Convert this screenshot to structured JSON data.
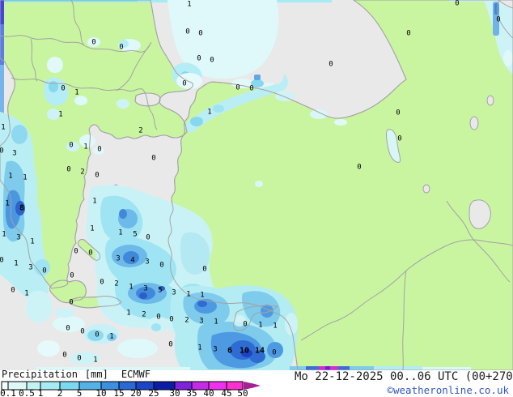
{
  "footer": {
    "legend_title": "Precipitation",
    "legend_unit": "[mm]",
    "legend_model": "ECMWF",
    "datetime": "Mo 22-12-2025 00..06 UTC (00+270",
    "copyright": "©weatheronline.co.uk"
  },
  "legend_scale": {
    "tick_labels": [
      "0.1",
      "0.5",
      "1",
      "2",
      "5",
      "10",
      "15",
      "20",
      "25",
      "30",
      "35",
      "40",
      "45",
      "50"
    ],
    "tick_x": [
      10,
      33,
      50,
      74,
      98,
      125,
      147,
      168,
      190,
      216,
      237,
      258,
      280,
      300
    ],
    "boundaries": [
      2,
      10,
      33,
      50,
      74,
      98,
      125,
      147,
      168,
      190,
      216,
      237,
      258,
      280,
      300
    ],
    "segment_colors": [
      "#f2fdfd",
      "#dcf8f8",
      "#c2f2f2",
      "#a6ebf2",
      "#7cdaf0",
      "#54b2e8",
      "#3b90e0",
      "#2a68d4",
      "#1b44c6",
      "#0a1da4",
      "#7e22dc",
      "#c52ae6",
      "#ee31f0",
      "#fb30cf"
    ],
    "arrow_color": "#a81f96",
    "bar_border_color": "#000000"
  },
  "map_colors": {
    "land": "#c9f5a1",
    "sea": "#e9e9e9",
    "coast": "#a3a3a3",
    "lake": "#d9f6f6"
  },
  "precip_values": [
    [
      234,
      4,
      "1",
      0
    ],
    [
      232,
      38,
      "0",
      0
    ],
    [
      248,
      40,
      "0",
      0
    ],
    [
      116,
      51,
      "0",
      0
    ],
    [
      150,
      57,
      "0",
      0
    ],
    [
      246,
      71,
      "0",
      0
    ],
    [
      262,
      73,
      "0",
      0
    ],
    [
      228,
      102,
      "0",
      0
    ],
    [
      294,
      107,
      "0",
      0
    ],
    [
      311,
      108,
      "0",
      0
    ],
    [
      565,
      3,
      "0",
      0
    ],
    [
      616,
      23,
      "0",
      0
    ],
    [
      505,
      40,
      "0",
      0
    ],
    [
      409,
      78,
      "0",
      0
    ],
    [
      78,
      108,
      "0",
      0
    ],
    [
      95,
      113,
      "1",
      0
    ],
    [
      259,
      137,
      "1",
      0
    ],
    [
      75,
      140,
      "1",
      0
    ],
    [
      492,
      138,
      "0",
      0
    ],
    [
      4,
      156,
      "1",
      0
    ],
    [
      174,
      160,
      "2",
      0
    ],
    [
      88,
      178,
      "0",
      0
    ],
    [
      106,
      180,
      "1",
      0
    ],
    [
      123,
      183,
      "0",
      0
    ],
    [
      2,
      185,
      "0",
      0
    ],
    [
      18,
      188,
      "3",
      0
    ],
    [
      190,
      194,
      "0",
      0
    ],
    [
      85,
      208,
      "0",
      0
    ],
    [
      102,
      211,
      "2",
      0
    ],
    [
      120,
      215,
      "0",
      0
    ],
    [
      13,
      216,
      "1",
      0
    ],
    [
      31,
      218,
      "1",
      0
    ],
    [
      494,
      170,
      "0",
      0
    ],
    [
      444,
      205,
      "0",
      0
    ],
    [
      9,
      250,
      "1",
      0
    ],
    [
      27,
      256,
      "8",
      1
    ],
    [
      117,
      247,
      "1",
      0
    ],
    [
      114,
      281,
      "1",
      0
    ],
    [
      5,
      288,
      "1",
      0
    ],
    [
      23,
      292,
      "3",
      0
    ],
    [
      40,
      297,
      "1",
      0
    ],
    [
      149,
      286,
      "1",
      0
    ],
    [
      167,
      288,
      "5",
      0
    ],
    [
      183,
      292,
      "0",
      0
    ],
    [
      2,
      320,
      "0",
      0
    ],
    [
      20,
      324,
      "1",
      0
    ],
    [
      38,
      329,
      "3",
      0
    ],
    [
      55,
      333,
      "0",
      0
    ],
    [
      94,
      309,
      "0",
      0
    ],
    [
      112,
      311,
      "0",
      0
    ],
    [
      146,
      318,
      "3",
      0
    ],
    [
      164,
      320,
      "4",
      0
    ],
    [
      182,
      322,
      "3",
      0
    ],
    [
      200,
      326,
      "0",
      0
    ],
    [
      253,
      331,
      "0",
      0
    ],
    [
      89,
      339,
      "0",
      0
    ],
    [
      126,
      347,
      "0",
      0
    ],
    [
      144,
      349,
      "2",
      0
    ],
    [
      162,
      353,
      "1",
      0
    ],
    [
      180,
      355,
      "3",
      0
    ],
    [
      198,
      357,
      "5",
      0
    ],
    [
      215,
      360,
      "3",
      0
    ],
    [
      233,
      362,
      "1",
      0
    ],
    [
      250,
      363,
      "1",
      0
    ],
    [
      16,
      357,
      "0",
      0
    ],
    [
      33,
      361,
      "1",
      0
    ],
    [
      88,
      372,
      "0",
      0
    ],
    [
      159,
      385,
      "1",
      0
    ],
    [
      178,
      387,
      "2",
      0
    ],
    [
      196,
      390,
      "0",
      0
    ],
    [
      212,
      393,
      "0",
      0
    ],
    [
      231,
      394,
      "2",
      0
    ],
    [
      249,
      395,
      "3",
      0
    ],
    [
      267,
      396,
      "1",
      0
    ],
    [
      303,
      399,
      "0",
      0
    ],
    [
      322,
      400,
      "1",
      0
    ],
    [
      340,
      401,
      "1",
      0
    ],
    [
      84,
      404,
      "0",
      0
    ],
    [
      102,
      408,
      "0",
      0
    ],
    [
      120,
      412,
      "0",
      0
    ],
    [
      138,
      414,
      "1",
      0
    ],
    [
      211,
      424,
      "0",
      0
    ],
    [
      247,
      428,
      "1",
      0
    ],
    [
      266,
      430,
      "3",
      0
    ],
    [
      284,
      432,
      "6",
      1
    ],
    [
      302,
      432,
      "10",
      1
    ],
    [
      321,
      432,
      "14",
      1
    ],
    [
      339,
      434,
      "0",
      0
    ],
    [
      80,
      437,
      "0",
      0
    ],
    [
      98,
      441,
      "0",
      0
    ],
    [
      118,
      443,
      "1",
      0
    ]
  ]
}
